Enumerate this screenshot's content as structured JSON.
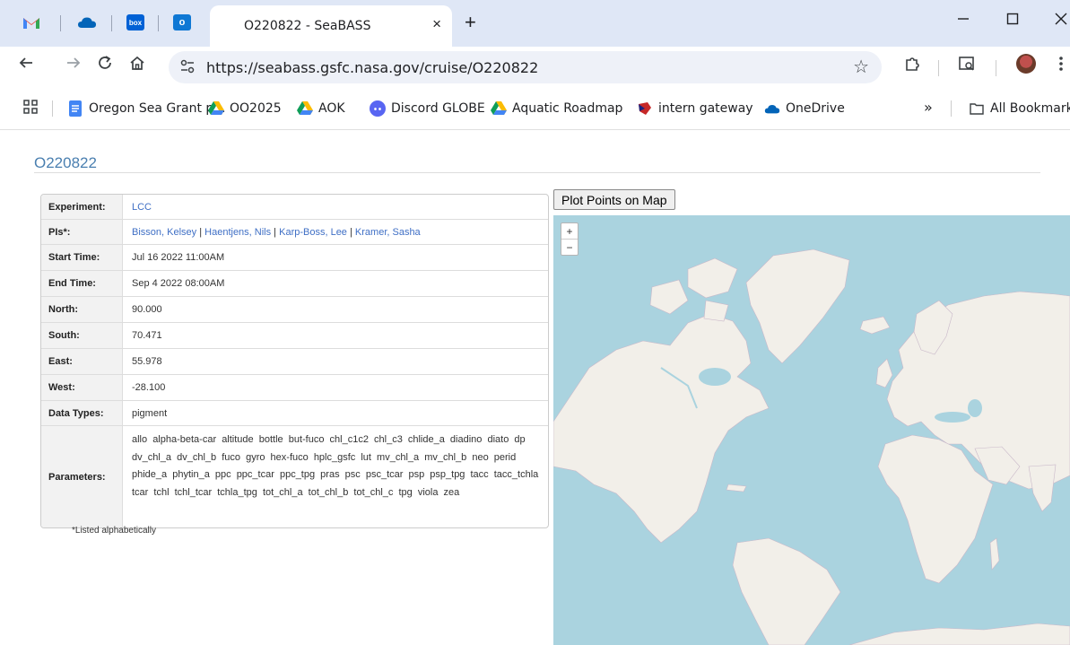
{
  "browser": {
    "pinned_tabs": [
      "gmail-icon",
      "onedrive-icon",
      "box-icon",
      "outlook-icon"
    ],
    "box_label": "box",
    "tab_title": "O220822 - SeaBASS",
    "tab_close": "×",
    "new_tab": "+",
    "url": "https://seabass.gsfc.nasa.gov/cruise/O220822",
    "bookmarks": [
      {
        "label": "Oregon Sea Grant p...",
        "icon": "docs-icon",
        "color": "#4285f4"
      },
      {
        "label": "OO2025",
        "icon": "drive-icon"
      },
      {
        "label": "AOK",
        "icon": "drive-icon"
      },
      {
        "label": "Discord GLOBE",
        "icon": "discord-icon",
        "color": "#5865f2"
      },
      {
        "label": "Aquatic Roadmap",
        "icon": "drive-icon"
      },
      {
        "label": "intern gateway",
        "icon": "gateway-icon",
        "color": "#c62828"
      },
      {
        "label": "OneDrive",
        "icon": "onedrive-icon",
        "color": "#0364b8"
      }
    ],
    "more_bookmarks": "»",
    "all_bookmarks": "All Bookmarks"
  },
  "page": {
    "title": "O220822",
    "rows": [
      {
        "label": "Experiment:",
        "value": "LCC",
        "link": true
      },
      {
        "label": "PIs*:",
        "pis": [
          "Bisson, Kelsey",
          "Haentjens, Nils",
          "Karp-Boss, Lee",
          "Kramer, Sasha"
        ]
      },
      {
        "label": "Start Time:",
        "value": "Jul 16 2022 11:00AM"
      },
      {
        "label": "End Time:",
        "value": "Sep 4 2022 08:00AM"
      },
      {
        "label": "North:",
        "value": "90.000"
      },
      {
        "label": "South:",
        "value": "70.471"
      },
      {
        "label": "East:",
        "value": "55.978"
      },
      {
        "label": "West:",
        "value": "-28.100"
      },
      {
        "label": "Data Types:",
        "value": "pigment"
      },
      {
        "label": "Parameters:",
        "params": true
      }
    ],
    "parameters": [
      "allo",
      "alpha-beta-car",
      "altitude",
      "bottle",
      "but-fuco",
      "chl_c1c2",
      "chl_c3",
      "chlide_a",
      "diadino",
      "diato",
      "dp",
      "dv_chl_a",
      "dv_chl_b",
      "fuco",
      "gyro",
      "hex-fuco",
      "hplc_gsfc",
      "lut",
      "mv_chl_a",
      "mv_chl_b",
      "neo",
      "perid",
      "phide_a",
      "phytin_a",
      "ppc",
      "ppc_tcar",
      "ppc_tpg",
      "pras",
      "psc",
      "psc_tcar",
      "psp",
      "psp_tpg",
      "tacc",
      "tacc_tchla",
      "tcar",
      "tchl",
      "tchl_tcar",
      "tchla_tpg",
      "tot_chl_a",
      "tot_chl_b",
      "tot_chl_c",
      "tpg",
      "viola",
      "zea"
    ],
    "footnote": "*Listed alphabetically",
    "plot_button": "Plot Points on Map",
    "zoom_in": "+",
    "zoom_out": "−",
    "colors": {
      "link": "#3f6fc5",
      "title": "#4a7fb0",
      "ocean": "#aad3df",
      "land": "#f2efe9"
    }
  }
}
